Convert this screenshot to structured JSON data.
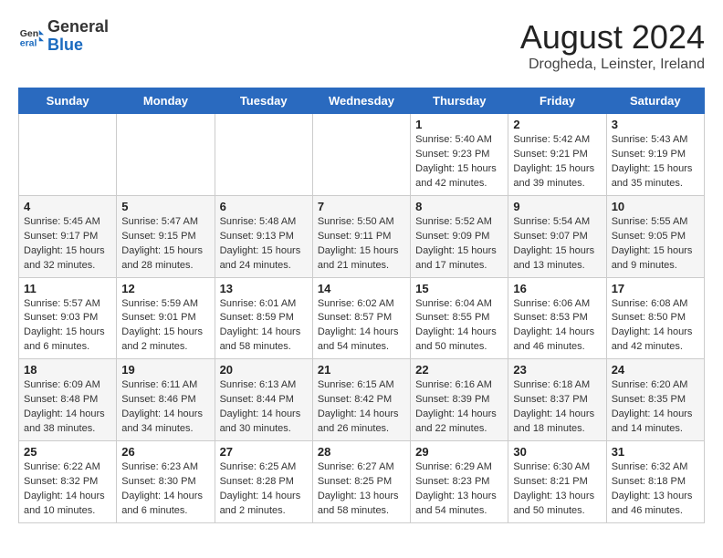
{
  "header": {
    "logo_general": "General",
    "logo_blue": "Blue",
    "title": "August 2024",
    "subtitle": "Drogheda, Leinster, Ireland"
  },
  "calendar": {
    "weekdays": [
      "Sunday",
      "Monday",
      "Tuesday",
      "Wednesday",
      "Thursday",
      "Friday",
      "Saturday"
    ],
    "weeks": [
      [
        {
          "day": "",
          "info": ""
        },
        {
          "day": "",
          "info": ""
        },
        {
          "day": "",
          "info": ""
        },
        {
          "day": "",
          "info": ""
        },
        {
          "day": "1",
          "info": "Sunrise: 5:40 AM\nSunset: 9:23 PM\nDaylight: 15 hours\nand 42 minutes."
        },
        {
          "day": "2",
          "info": "Sunrise: 5:42 AM\nSunset: 9:21 PM\nDaylight: 15 hours\nand 39 minutes."
        },
        {
          "day": "3",
          "info": "Sunrise: 5:43 AM\nSunset: 9:19 PM\nDaylight: 15 hours\nand 35 minutes."
        }
      ],
      [
        {
          "day": "4",
          "info": "Sunrise: 5:45 AM\nSunset: 9:17 PM\nDaylight: 15 hours\nand 32 minutes."
        },
        {
          "day": "5",
          "info": "Sunrise: 5:47 AM\nSunset: 9:15 PM\nDaylight: 15 hours\nand 28 minutes."
        },
        {
          "day": "6",
          "info": "Sunrise: 5:48 AM\nSunset: 9:13 PM\nDaylight: 15 hours\nand 24 minutes."
        },
        {
          "day": "7",
          "info": "Sunrise: 5:50 AM\nSunset: 9:11 PM\nDaylight: 15 hours\nand 21 minutes."
        },
        {
          "day": "8",
          "info": "Sunrise: 5:52 AM\nSunset: 9:09 PM\nDaylight: 15 hours\nand 17 minutes."
        },
        {
          "day": "9",
          "info": "Sunrise: 5:54 AM\nSunset: 9:07 PM\nDaylight: 15 hours\nand 13 minutes."
        },
        {
          "day": "10",
          "info": "Sunrise: 5:55 AM\nSunset: 9:05 PM\nDaylight: 15 hours\nand 9 minutes."
        }
      ],
      [
        {
          "day": "11",
          "info": "Sunrise: 5:57 AM\nSunset: 9:03 PM\nDaylight: 15 hours\nand 6 minutes."
        },
        {
          "day": "12",
          "info": "Sunrise: 5:59 AM\nSunset: 9:01 PM\nDaylight: 15 hours\nand 2 minutes."
        },
        {
          "day": "13",
          "info": "Sunrise: 6:01 AM\nSunset: 8:59 PM\nDaylight: 14 hours\nand 58 minutes."
        },
        {
          "day": "14",
          "info": "Sunrise: 6:02 AM\nSunset: 8:57 PM\nDaylight: 14 hours\nand 54 minutes."
        },
        {
          "day": "15",
          "info": "Sunrise: 6:04 AM\nSunset: 8:55 PM\nDaylight: 14 hours\nand 50 minutes."
        },
        {
          "day": "16",
          "info": "Sunrise: 6:06 AM\nSunset: 8:53 PM\nDaylight: 14 hours\nand 46 minutes."
        },
        {
          "day": "17",
          "info": "Sunrise: 6:08 AM\nSunset: 8:50 PM\nDaylight: 14 hours\nand 42 minutes."
        }
      ],
      [
        {
          "day": "18",
          "info": "Sunrise: 6:09 AM\nSunset: 8:48 PM\nDaylight: 14 hours\nand 38 minutes."
        },
        {
          "day": "19",
          "info": "Sunrise: 6:11 AM\nSunset: 8:46 PM\nDaylight: 14 hours\nand 34 minutes."
        },
        {
          "day": "20",
          "info": "Sunrise: 6:13 AM\nSunset: 8:44 PM\nDaylight: 14 hours\nand 30 minutes."
        },
        {
          "day": "21",
          "info": "Sunrise: 6:15 AM\nSunset: 8:42 PM\nDaylight: 14 hours\nand 26 minutes."
        },
        {
          "day": "22",
          "info": "Sunrise: 6:16 AM\nSunset: 8:39 PM\nDaylight: 14 hours\nand 22 minutes."
        },
        {
          "day": "23",
          "info": "Sunrise: 6:18 AM\nSunset: 8:37 PM\nDaylight: 14 hours\nand 18 minutes."
        },
        {
          "day": "24",
          "info": "Sunrise: 6:20 AM\nSunset: 8:35 PM\nDaylight: 14 hours\nand 14 minutes."
        }
      ],
      [
        {
          "day": "25",
          "info": "Sunrise: 6:22 AM\nSunset: 8:32 PM\nDaylight: 14 hours\nand 10 minutes."
        },
        {
          "day": "26",
          "info": "Sunrise: 6:23 AM\nSunset: 8:30 PM\nDaylight: 14 hours\nand 6 minutes."
        },
        {
          "day": "27",
          "info": "Sunrise: 6:25 AM\nSunset: 8:28 PM\nDaylight: 14 hours\nand 2 minutes."
        },
        {
          "day": "28",
          "info": "Sunrise: 6:27 AM\nSunset: 8:25 PM\nDaylight: 13 hours\nand 58 minutes."
        },
        {
          "day": "29",
          "info": "Sunrise: 6:29 AM\nSunset: 8:23 PM\nDaylight: 13 hours\nand 54 minutes."
        },
        {
          "day": "30",
          "info": "Sunrise: 6:30 AM\nSunset: 8:21 PM\nDaylight: 13 hours\nand 50 minutes."
        },
        {
          "day": "31",
          "info": "Sunrise: 6:32 AM\nSunset: 8:18 PM\nDaylight: 13 hours\nand 46 minutes."
        }
      ]
    ]
  }
}
